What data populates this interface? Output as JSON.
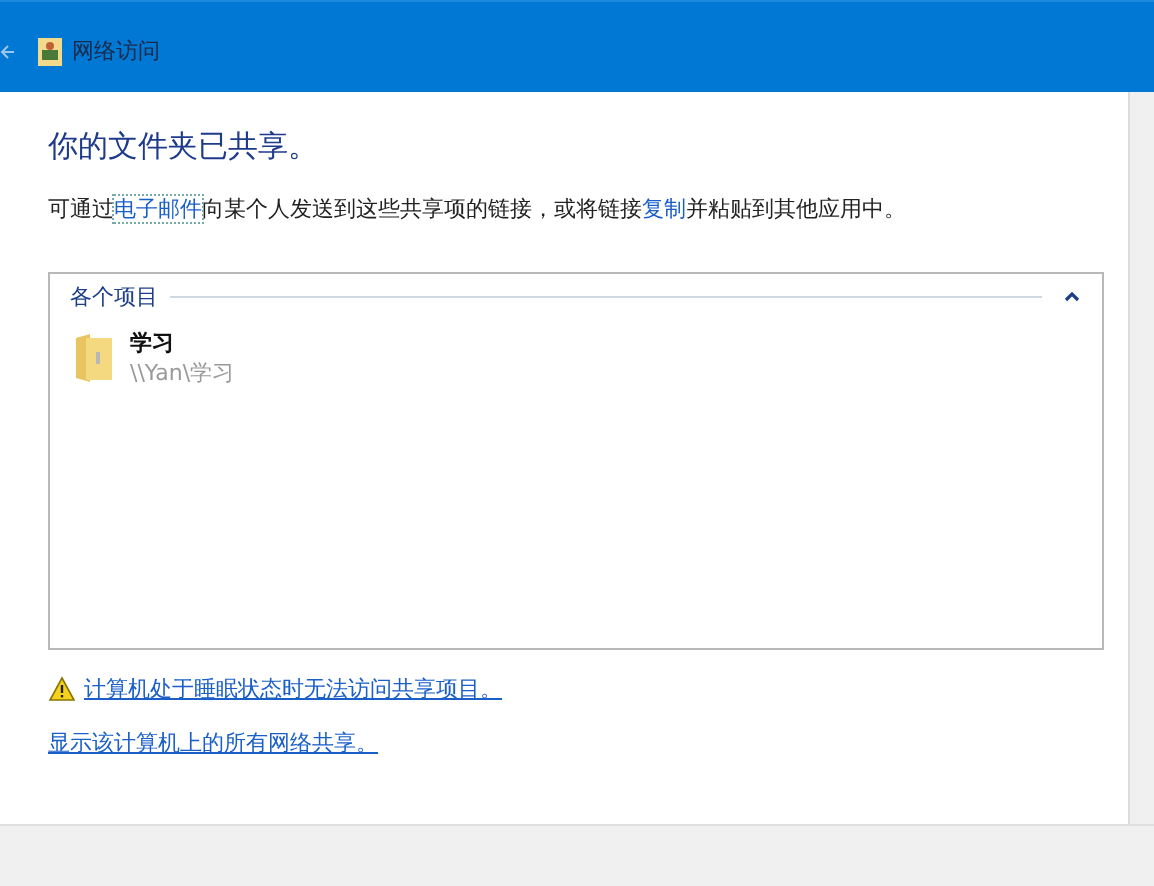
{
  "window": {
    "title": "网络访问"
  },
  "heading": "你的文件夹已共享。",
  "intro": [
    {
      "kind": "text",
      "text": "可通过"
    },
    {
      "kind": "link",
      "text": "电子邮件"
    },
    {
      "kind": "text",
      "text": "向某个人发送到这些共享项的链接，或将链接"
    },
    {
      "kind": "link",
      "text": "复制"
    },
    {
      "kind": "text",
      "text": "并粘贴到其他应用中。"
    }
  ],
  "group": {
    "label": "各个项目",
    "expanded": true,
    "items": [
      {
        "name": "学习",
        "path": "\\\\Yan\\学习"
      }
    ]
  },
  "links": [
    {
      "kind": "warning",
      "text": "计算机处于睡眠状态时无法访问共享项目。"
    },
    {
      "kind": "plain",
      "text": "显示该计算机上的所有网络共享。"
    }
  ]
}
